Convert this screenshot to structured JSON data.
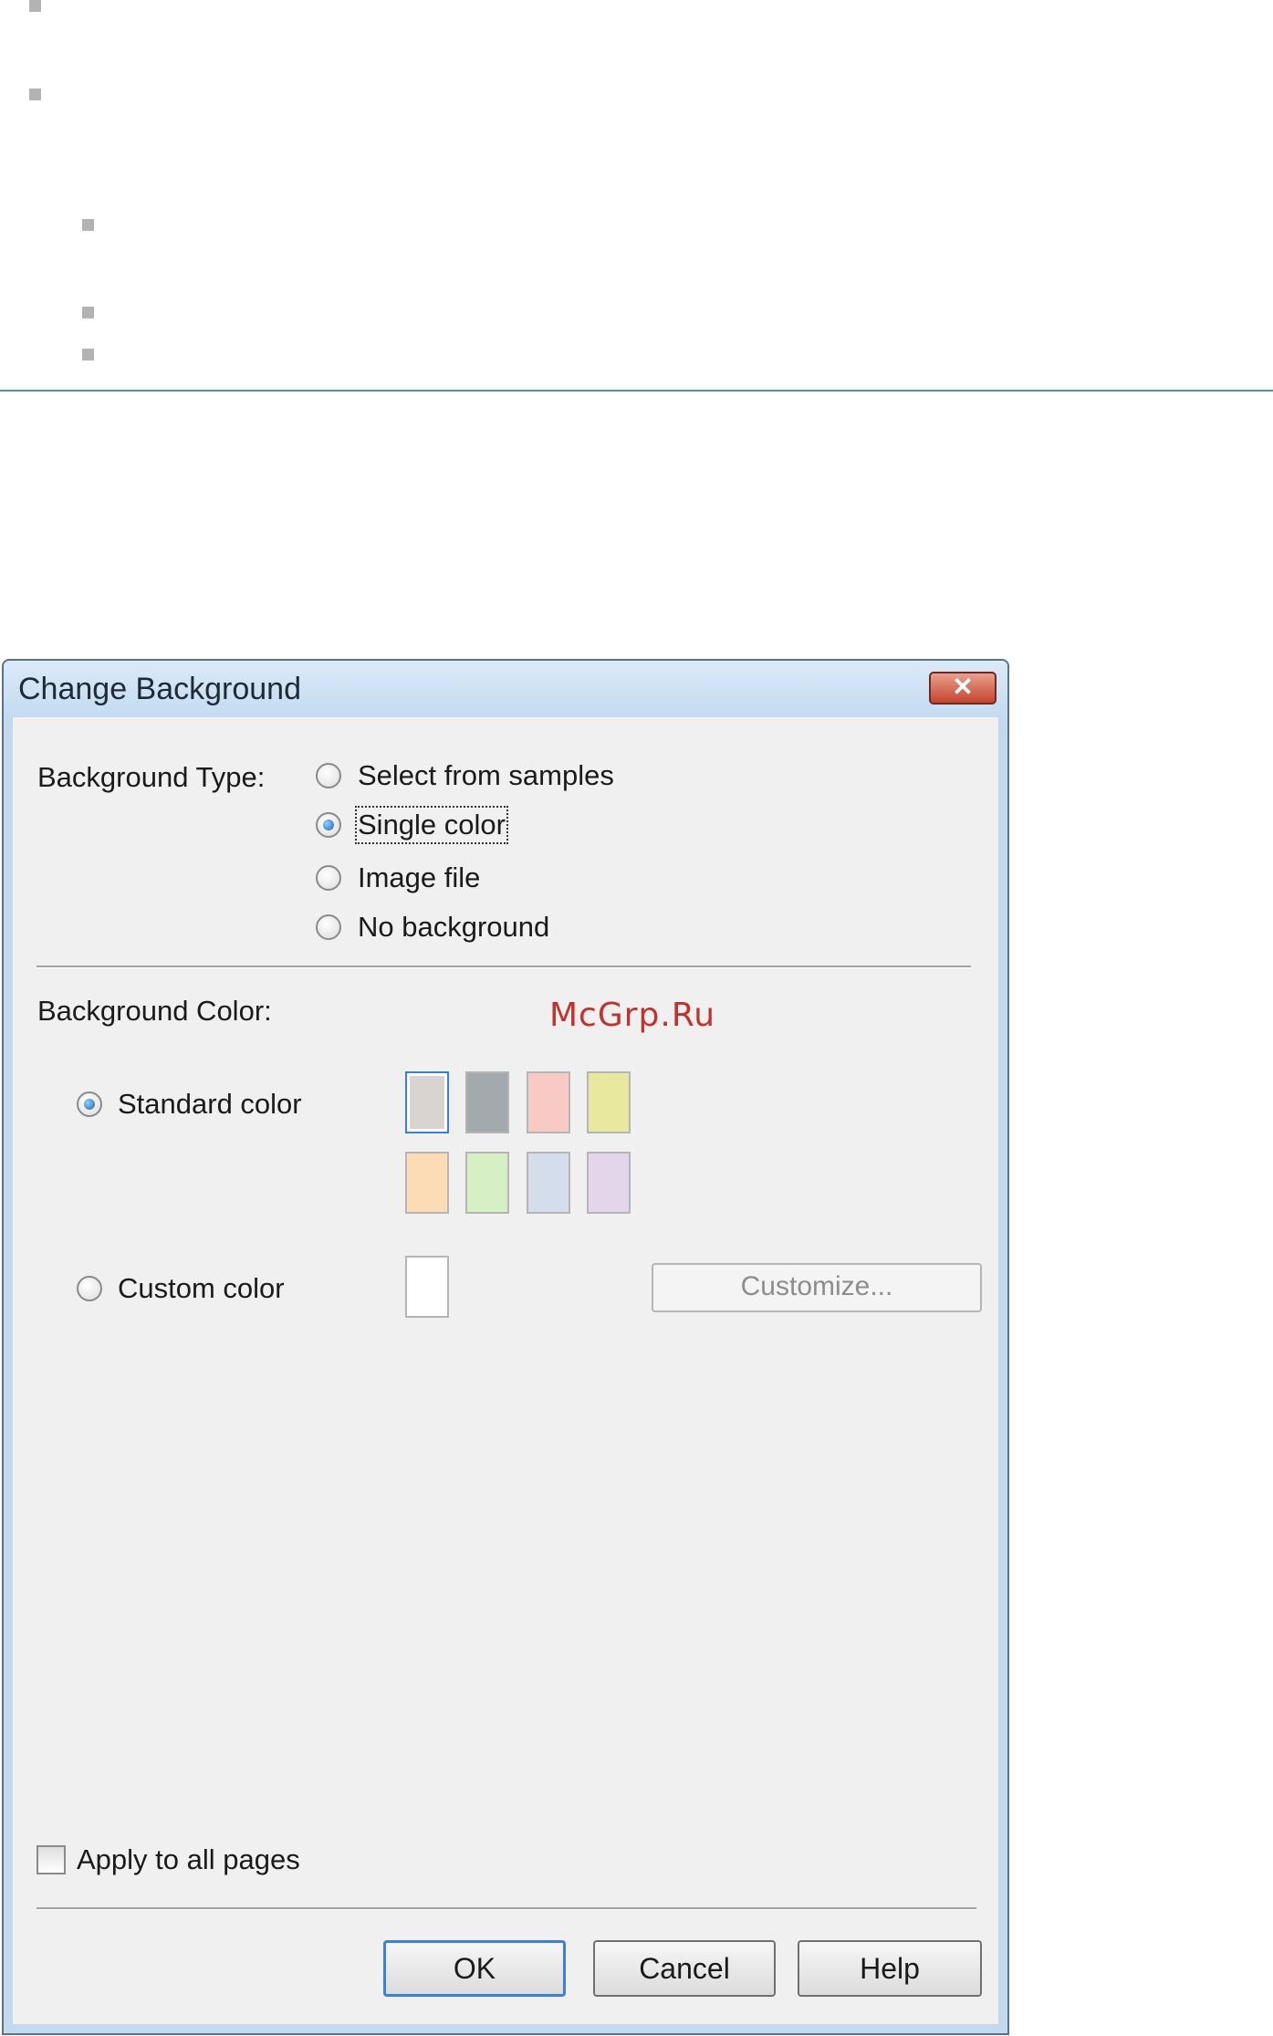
{
  "dialog": {
    "title": "Change Background",
    "close_glyph": "✕",
    "background_type": {
      "label": "Background Type:",
      "options": [
        {
          "label": "Select from samples",
          "checked": false
        },
        {
          "label": "Single color",
          "checked": true
        },
        {
          "label": "Image file",
          "checked": false
        },
        {
          "label": "No background",
          "checked": false
        }
      ]
    },
    "background_color": {
      "label": "Background Color:",
      "standard_label": "Standard color",
      "standard_checked": true,
      "custom_label": "Custom color",
      "custom_checked": false,
      "custom_swatch_color": "#ffffff",
      "customize_button": "Customize...",
      "swatches": [
        "#d9d4d0",
        "#a3aaad",
        "#f7cbc3",
        "#e8e89f",
        "#fbdcb4",
        "#d6f0c4",
        "#d5dcec",
        "#e4d6ea"
      ],
      "selected_swatch": 0
    },
    "apply_all_label": "Apply to all pages",
    "apply_all_checked": false,
    "buttons": {
      "ok": "OK",
      "cancel": "Cancel",
      "help": "Help"
    }
  },
  "watermark": "McGrp.Ru",
  "colors": {
    "accent_rule": "#4a9aa0",
    "bullet": "#b3b3b3",
    "title_bar": "#c4dbf0"
  }
}
